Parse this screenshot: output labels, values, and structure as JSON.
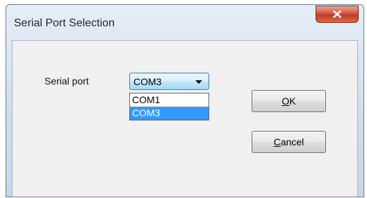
{
  "window": {
    "title": "Serial Port Selection"
  },
  "form": {
    "serial_port_label": "Serial port",
    "serial_port_value": "COM3",
    "options": [
      "COM1",
      "COM3"
    ],
    "selected_option": "COM3"
  },
  "buttons": {
    "ok_mnemonic": "O",
    "ok_rest": "K",
    "cancel_mnemonic": "C",
    "cancel_rest": "ancel"
  },
  "icons": {
    "close": "close-icon",
    "dropdown": "chevron-down-icon"
  },
  "colors": {
    "selection_highlight": "#3399ff",
    "close_button": "#c13a22"
  }
}
